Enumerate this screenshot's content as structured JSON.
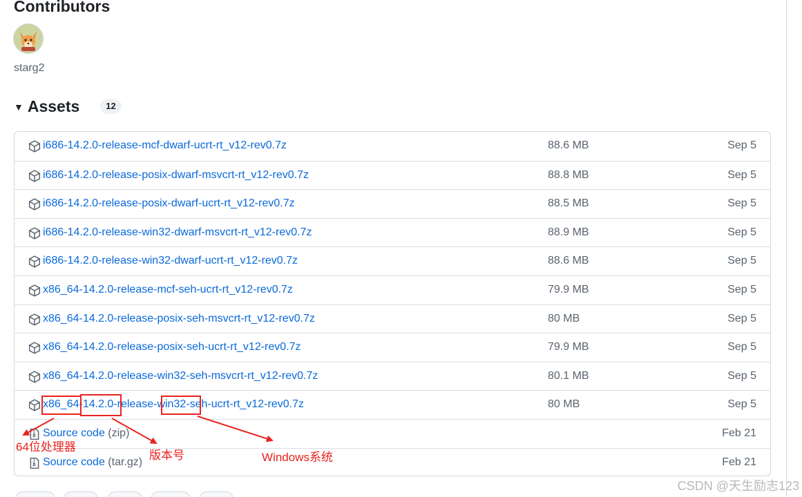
{
  "contributors": {
    "title": "Contributors",
    "username": "starg2"
  },
  "assets": {
    "title": "Assets",
    "count": "12",
    "rows": [
      {
        "name": "i686-14.2.0-release-mcf-dwarf-ucrt-rt_v12-rev0.7z",
        "size": "88.6 MB",
        "date": "Sep 5"
      },
      {
        "name": "i686-14.2.0-release-posix-dwarf-msvcrt-rt_v12-rev0.7z",
        "size": "88.8 MB",
        "date": "Sep 5"
      },
      {
        "name": "i686-14.2.0-release-posix-dwarf-ucrt-rt_v12-rev0.7z",
        "size": "88.5 MB",
        "date": "Sep 5"
      },
      {
        "name": "i686-14.2.0-release-win32-dwarf-msvcrt-rt_v12-rev0.7z",
        "size": "88.9 MB",
        "date": "Sep 5"
      },
      {
        "name": "i686-14.2.0-release-win32-dwarf-ucrt-rt_v12-rev0.7z",
        "size": "88.6 MB",
        "date": "Sep 5"
      },
      {
        "name": "x86_64-14.2.0-release-mcf-seh-ucrt-rt_v12-rev0.7z",
        "size": "79.9 MB",
        "date": "Sep 5"
      },
      {
        "name": "x86_64-14.2.0-release-posix-seh-msvcrt-rt_v12-rev0.7z",
        "size": "80 MB",
        "date": "Sep 5"
      },
      {
        "name": "x86_64-14.2.0-release-posix-seh-ucrt-rt_v12-rev0.7z",
        "size": "79.9 MB",
        "date": "Sep 5"
      },
      {
        "name": "x86_64-14.2.0-release-win32-seh-msvcrt-rt_v12-rev0.7z",
        "size": "80.1 MB",
        "date": "Sep 5"
      },
      {
        "name": "x86_64-14.2.0-release-win32-seh-ucrt-rt_v12-rev0.7z",
        "size": "80 MB",
        "date": "Sep 5"
      }
    ],
    "source_zip": {
      "label": "Source code",
      "ext": "(zip)",
      "date": "Feb 21"
    },
    "source_targz": {
      "label": "Source code",
      "ext": "(tar.gz)",
      "date": "Feb 21"
    }
  },
  "annotations": {
    "arch": "64位处理器",
    "version": "版本号",
    "os": "Windows系统",
    "color": "#e8231f"
  },
  "watermark": "CSDN @天生励志123",
  "icons": {
    "package": "package-icon",
    "file_zip": "file-zip-icon",
    "triangle": "triangle-down-icon"
  }
}
